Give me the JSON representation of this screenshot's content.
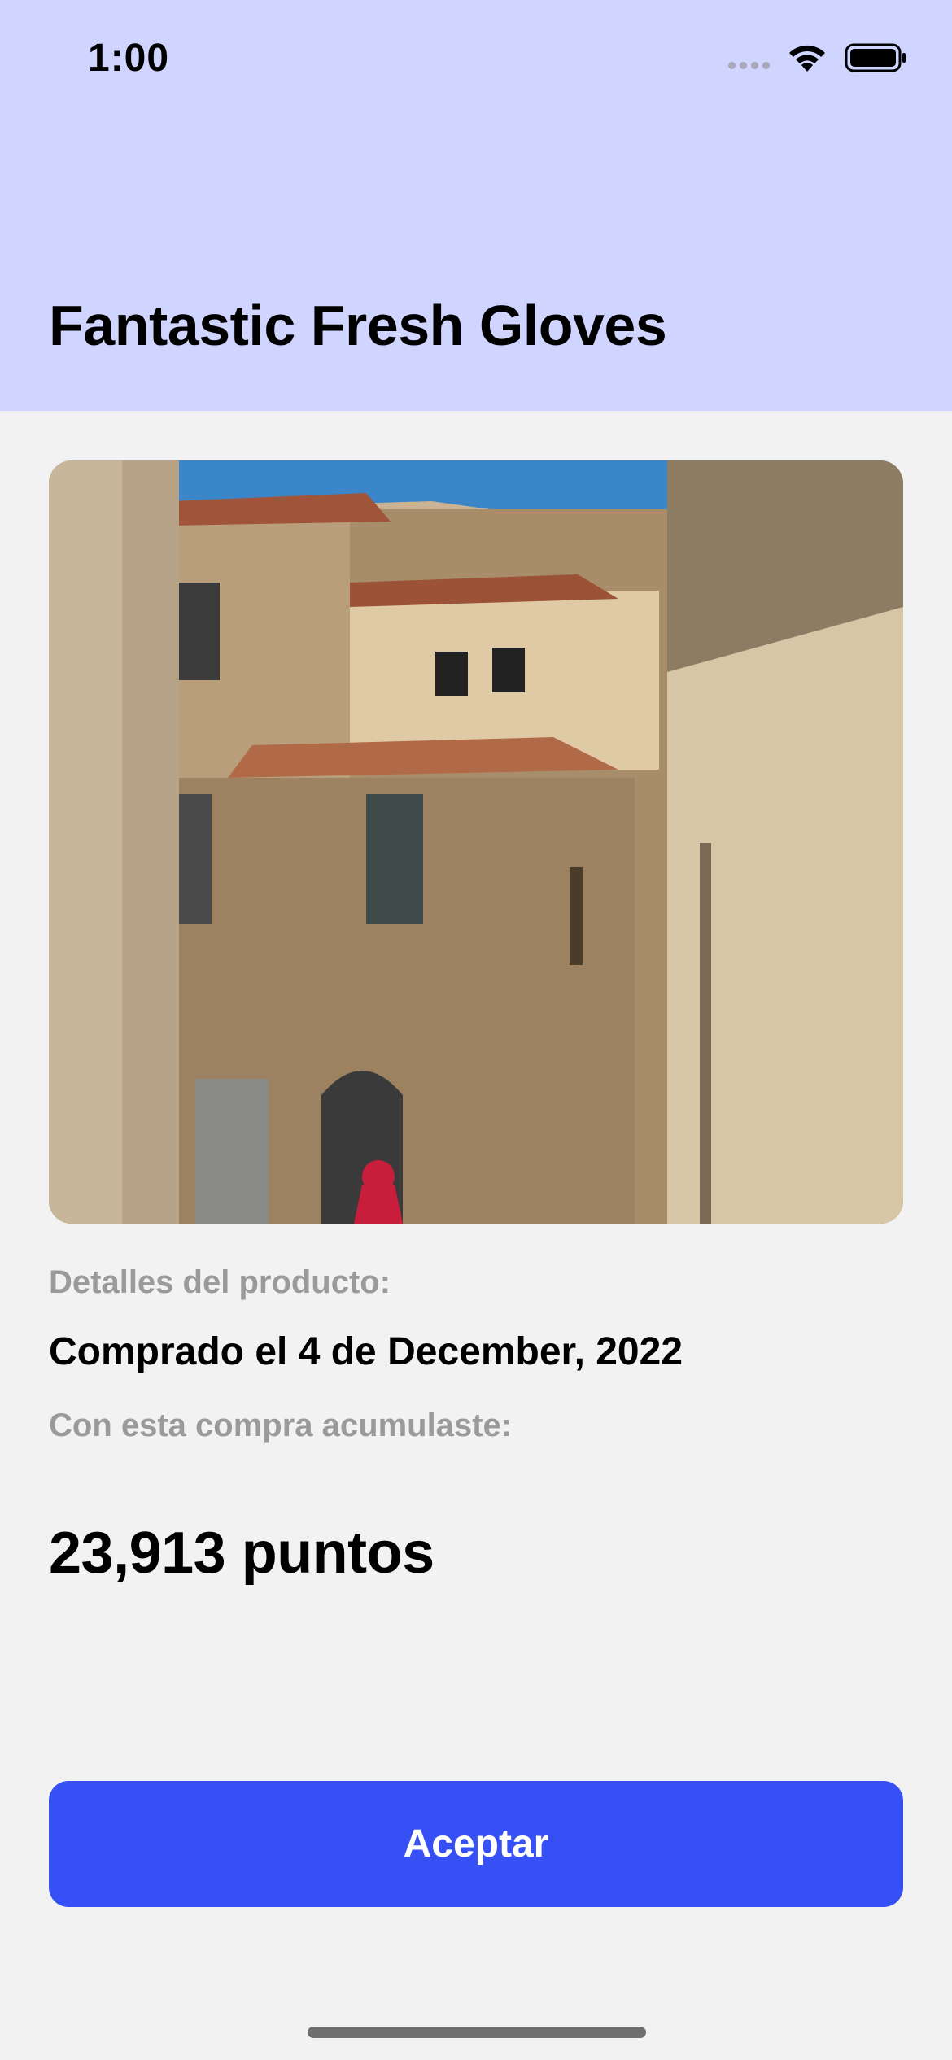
{
  "status_bar": {
    "time": "1:00",
    "icons": [
      "cellular-signal-icon",
      "wifi-icon",
      "battery-icon"
    ]
  },
  "header": {
    "title": "Fantastic Fresh Gloves",
    "background": "#d0d5ff"
  },
  "product": {
    "image": "building-street-photo",
    "details_label": "Detalles del producto:",
    "purchase_date": "Comprado el 4 de December, 2022",
    "accumulated_label": "Con esta compra acumulaste:",
    "points": "23,913 puntos"
  },
  "actions": {
    "accept_label": "Aceptar",
    "accent": "#3650f6"
  }
}
